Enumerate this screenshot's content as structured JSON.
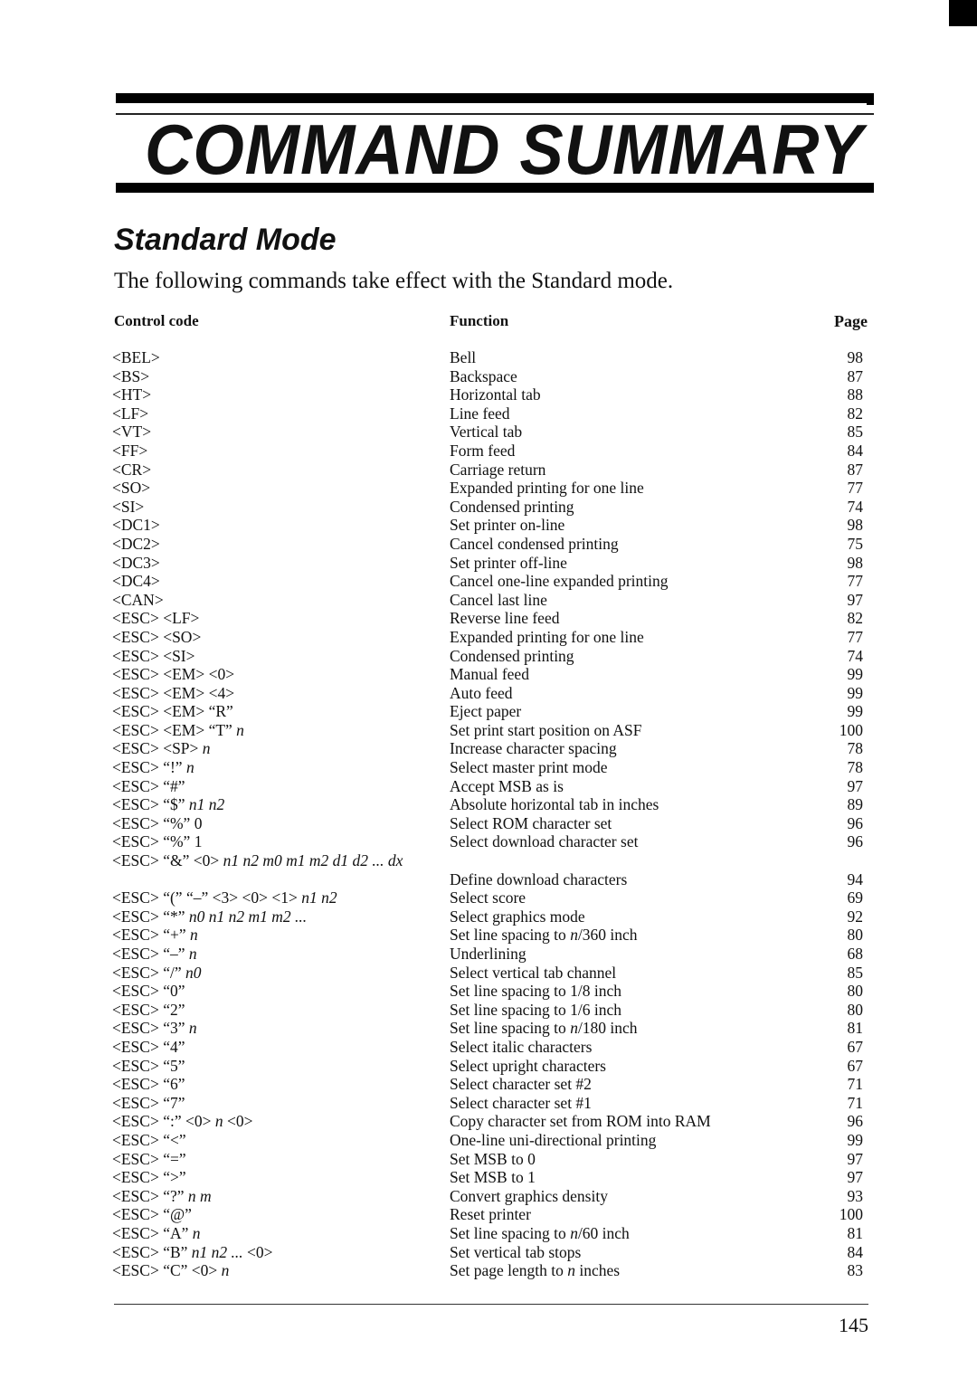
{
  "header": {
    "title": "COMMAND SUMMARY",
    "section": "Standard Mode",
    "intro": "The following commands take effect with the Standard mode."
  },
  "table": {
    "columns": {
      "code": "Control code",
      "function": "Function",
      "page": "Page"
    },
    "rows": [
      {
        "code": "<BEL>",
        "function": "Bell",
        "page": "98"
      },
      {
        "code": "<BS>",
        "function": "Backspace",
        "page": "87"
      },
      {
        "code": "<HT>",
        "function": "Horizontal tab",
        "page": "88"
      },
      {
        "code": "<LF>",
        "function": "Line feed",
        "page": "82"
      },
      {
        "code": "<VT>",
        "function": "Vertical tab",
        "page": "85"
      },
      {
        "code": "<FF>",
        "function": "Form feed",
        "page": "84"
      },
      {
        "code": "<CR>",
        "function": "Carriage return",
        "page": "87"
      },
      {
        "code": "<SO>",
        "function": "Expanded printing for one line",
        "page": "77"
      },
      {
        "code": "<SI>",
        "function": "Condensed printing",
        "page": "74"
      },
      {
        "code": "<DC1>",
        "function": "Set printer on-line",
        "page": "98"
      },
      {
        "code": "<DC2>",
        "function": "Cancel condensed printing",
        "page": "75"
      },
      {
        "code": "<DC3>",
        "function": "Set printer off-line",
        "page": "98"
      },
      {
        "code": "<DC4>",
        "function": "Cancel one-line expanded printing",
        "page": "77"
      },
      {
        "code": "<CAN>",
        "function": "Cancel last line",
        "page": "97"
      },
      {
        "code": "<ESC> <LF>",
        "function": "Reverse line feed",
        "page": "82"
      },
      {
        "code": "<ESC> <SO>",
        "function": "Expanded printing for one line",
        "page": "77"
      },
      {
        "code": "<ESC> <SI>",
        "function": "Condensed printing",
        "page": "74"
      },
      {
        "code": "<ESC> <EM> <0>",
        "function": "Manual feed",
        "page": "99"
      },
      {
        "code": "<ESC> <EM> <4>",
        "function": "Auto feed",
        "page": "99"
      },
      {
        "code": "<ESC> <EM> “R”",
        "function": "Eject paper",
        "page": "99"
      },
      {
        "code": "<ESC> <EM> “T”",
        "code_args": "n",
        "function": "Set print start position on ASF",
        "page": "100"
      },
      {
        "code": "<ESC> <SP>",
        "code_args": "n",
        "function": "Increase character spacing",
        "page": "78"
      },
      {
        "code": "<ESC> “!”",
        "code_args": "n",
        "function": "Select master print mode",
        "page": "78"
      },
      {
        "code": "<ESC> “#”",
        "function": "Accept MSB as is",
        "page": "97"
      },
      {
        "code": "<ESC> “$”",
        "code_args": "n1 n2",
        "function": "Absolute horizontal tab in inches",
        "page": "89"
      },
      {
        "code": "<ESC> “%” 0",
        "function": "Select ROM character set",
        "page": "96"
      },
      {
        "code": "<ESC> “%” 1",
        "function": "Select download character set",
        "page": "96"
      },
      {
        "code": "<ESC> “&” <0>",
        "code_args": "n1 n2 m0 m1 m2 d1 d2 ... dx",
        "function": "",
        "page": "",
        "overflow": true
      },
      {
        "code": "",
        "function": "Define download characters",
        "page": "94"
      },
      {
        "code": "<ESC> “(” “–” <3> <0> <1>",
        "code_args": "n1 n2",
        "function": "Select score",
        "page": "69"
      },
      {
        "code": "<ESC> “*”",
        "code_args": "n0 n1 n2  m1 m2 ...",
        "function": "Select graphics mode",
        "page": "92"
      },
      {
        "code": "<ESC> “+”",
        "code_args": "n",
        "function": "Set line spacing to n/360 inch",
        "page": "80"
      },
      {
        "code": "<ESC> “–”",
        "code_args": "n",
        "function": "Underlining",
        "page": "68"
      },
      {
        "code": "<ESC> “/”",
        "code_args": "n0",
        "function": "Select vertical tab channel",
        "page": "85"
      },
      {
        "code": "<ESC> “0”",
        "function": "Set line spacing to 1/8 inch",
        "page": "80"
      },
      {
        "code": "<ESC> “2”",
        "function": "Set line spacing to 1/6 inch",
        "page": "80"
      },
      {
        "code": "<ESC> “3”",
        "code_args": "n",
        "function": "Set line spacing to n/180 inch",
        "page": "81"
      },
      {
        "code": "<ESC> “4”",
        "function": "Select italic characters",
        "page": "67"
      },
      {
        "code": "<ESC> “5”",
        "function": "Select upright characters",
        "page": "67"
      },
      {
        "code": "<ESC> “6”",
        "function": "Select character set #2",
        "page": "71"
      },
      {
        "code": "<ESC> “7”",
        "function": "Select character set #1",
        "page": "71"
      },
      {
        "code": "<ESC> “:” <0>",
        "code_args": "n",
        "code_tail": "<0>",
        "function": "Copy character set from ROM into RAM",
        "page": "96"
      },
      {
        "code": "<ESC> “<”",
        "function": "One-line uni-directional printing",
        "page": "99"
      },
      {
        "code": "<ESC> “=”",
        "function": "Set MSB to 0",
        "page": "97"
      },
      {
        "code": "<ESC> “>”",
        "function": "Set MSB to 1",
        "page": "97"
      },
      {
        "code": "<ESC> “?”",
        "code_args": "n m",
        "function": "Convert graphics density",
        "page": "93"
      },
      {
        "code": "<ESC> “@”",
        "function": "Reset printer",
        "page": "100"
      },
      {
        "code": "<ESC> “A”",
        "code_args": "n",
        "function": "Set line spacing to n/60 inch",
        "page": "81"
      },
      {
        "code": "<ESC> “B”",
        "code_args": "n1 n2 ...",
        "code_tail": "<0>",
        "function": "Set vertical tab stops",
        "page": "84"
      },
      {
        "code": "<ESC> “C” <0>",
        "code_args": "n",
        "function": "Set page length to n inches",
        "page": "83"
      }
    ]
  },
  "footer": {
    "page_number": "145"
  }
}
